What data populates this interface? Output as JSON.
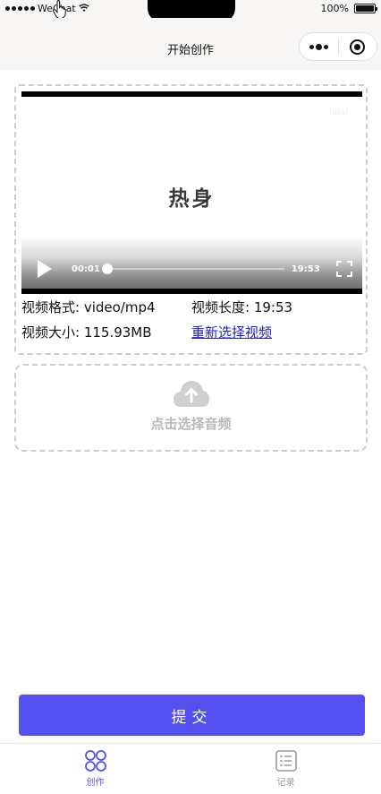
{
  "status_bar": {
    "carrier": "WeChat",
    "battery_text": "100%"
  },
  "nav": {
    "title": "开始创作"
  },
  "video": {
    "watermark": "lalal",
    "frame_title": "热身",
    "current_time": "00:01",
    "duration_time": "19:53",
    "progress_fraction": 0.01,
    "format_text": "视频格式: video/mp4",
    "length_text": "视频长度: 19:53",
    "size_text": "视频大小: 115.93MB",
    "reselect_text": "重新选择视频"
  },
  "audio": {
    "label": "点击选择音频",
    "icon": "cloud-upload-icon"
  },
  "submit_label": "提交",
  "tabs": [
    {
      "label": "创作",
      "icon": "create-icon",
      "active": true
    },
    {
      "label": "记录",
      "icon": "list-icon",
      "active": false
    }
  ],
  "colors": {
    "accent": "#5450f0",
    "dashed_border": "#cccccc",
    "link": "#2222cc"
  }
}
